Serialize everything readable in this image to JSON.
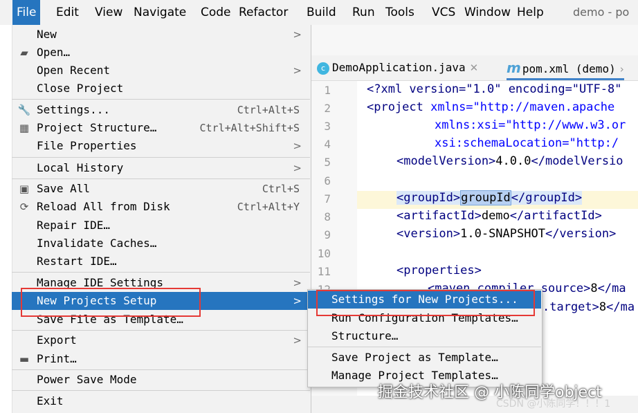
{
  "menubar": {
    "items": [
      "File",
      "Edit",
      "View",
      "Navigate",
      "Code",
      "Refactor",
      "Build",
      "Run",
      "Tools",
      "VCS",
      "Window",
      "Help"
    ],
    "project_title": "demo - po"
  },
  "editor": {
    "tabs": [
      {
        "label": "DemoApplication.java",
        "icon": "java-class-icon"
      },
      {
        "label": "pom.xml (demo)",
        "icon": "maven-icon"
      }
    ],
    "line_numbers": [
      "1",
      "2",
      "3",
      "4",
      "5",
      "6",
      "7",
      "8",
      "9",
      "10",
      "11",
      "12"
    ],
    "code": {
      "l1a": "<?xml version=\"1.0\" encoding=\"UTF-8\"",
      "l2a": "<project",
      "l2b": " xmlns=\"http://maven.apache",
      "l3a": "xmlns:xsi=\"http://www.w3.or",
      "l4a": "xsi:schemaLocation=\"http:/",
      "l5a": "<modelVersion>",
      "l5b": "4.0.0",
      "l5c": "</modelVersio",
      "l7a": "<groupId>",
      "l7b": "groupId",
      "l7c": "</groupId>",
      "l8a": "<artifactId>",
      "l8b": "demo",
      "l8c": "</artifactId>",
      "l9a": "<version>",
      "l9b": "1.0-SNAPSHOT",
      "l9c": "</version>",
      "l11a": "<properties>",
      "l12a": "<maven.compiler.source>",
      "l12b": "8",
      "l12c": "</ma",
      "l13a": ".target>",
      "l13b": "8",
      "l13c": "</ma"
    }
  },
  "file_menu": {
    "new": "New",
    "open": "Open…",
    "open_recent": "Open Recent",
    "close_project": "Close Project",
    "settings": "Settings...",
    "settings_sc": "Ctrl+Alt+S",
    "project_structure": "Project Structure…",
    "project_structure_sc": "Ctrl+Alt+Shift+S",
    "file_properties": "File Properties",
    "local_history": "Local History",
    "save_all": "Save All",
    "save_all_sc": "Ctrl+S",
    "reload": "Reload All from Disk",
    "reload_sc": "Ctrl+Alt+Y",
    "repair_ide": "Repair IDE…",
    "invalidate_caches": "Invalidate Caches…",
    "restart_ide": "Restart IDE…",
    "manage_ide_settings": "Manage IDE Settings",
    "new_projects_setup": "New Projects Setup",
    "save_file_as_template": "Save File as Template…",
    "export": "Export",
    "print": "Print…",
    "power_save_mode": "Power Save Mode",
    "exit": "Exit"
  },
  "submenu": {
    "settings_for_new_projects": "Settings for New Projects...",
    "run_configuration_templates": "Run Configuration Templates…",
    "structure": "Structure…",
    "save_project_as_template": "Save Project as Template…",
    "manage_project_templates": "Manage Project Templates…"
  },
  "watermark": {
    "main": "掘金技术社区 @ 小陈同学object",
    "secondary": "CSDN @小陈同学！！！1"
  },
  "colors": {
    "selection": "#2675bf",
    "highlight_box": "#e53935",
    "xml_tag": "#000080",
    "xml_attr": "#0000ff",
    "xml_string": "#008000"
  }
}
